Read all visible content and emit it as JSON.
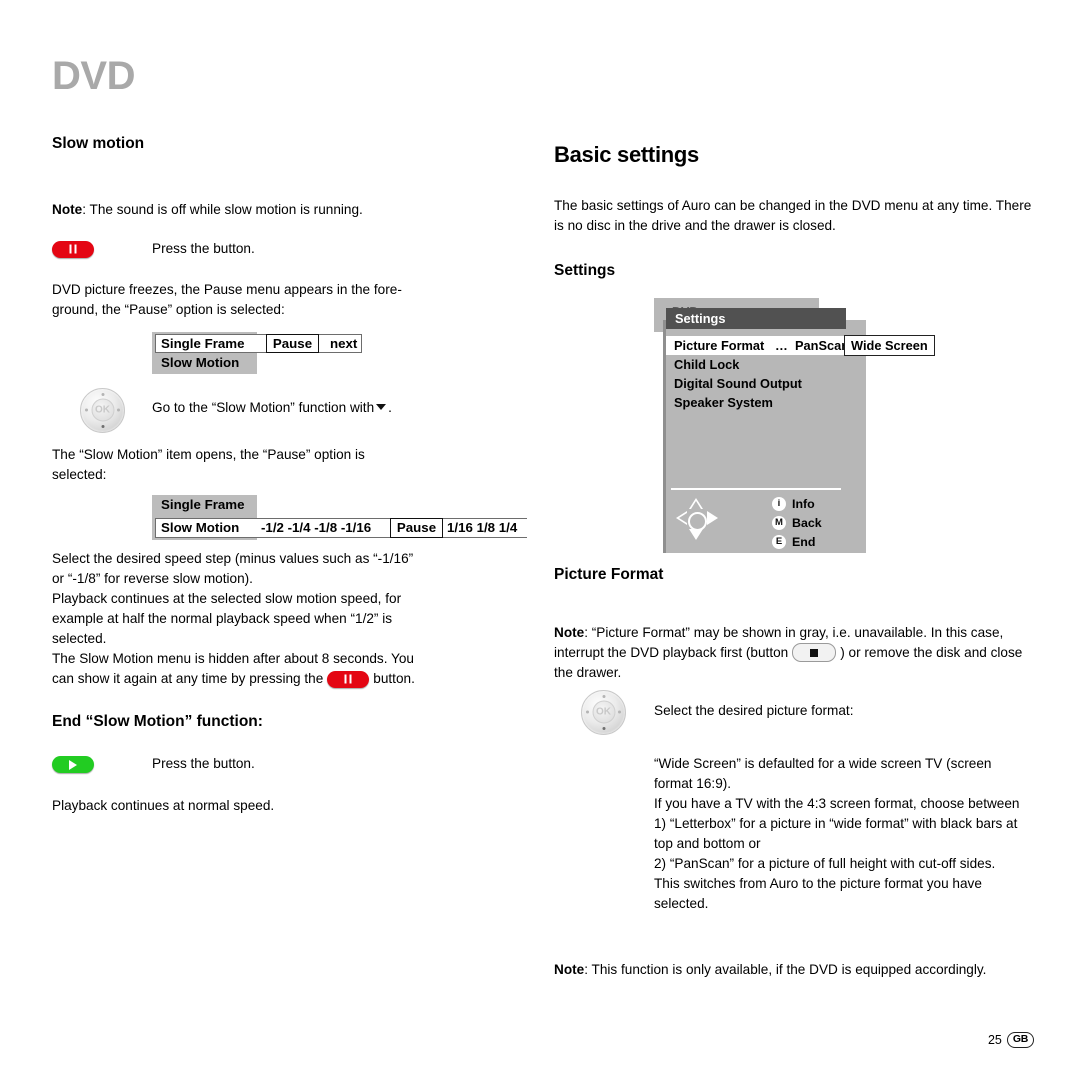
{
  "document": {
    "chapter_title": "DVD",
    "page_number": "25",
    "country_code": "GB"
  },
  "left_column": {
    "section_title": "Slow motion",
    "note_1": {
      "label": "Note",
      "text": ": The sound is off while slow motion is running."
    },
    "step_pause": {
      "button_icon": "pause-button-icon",
      "text": "Press the button."
    },
    "paragraph_1": "DVD picture freezes, the Pause menu appears in the fore-ground, the “Pause” option is selected:",
    "osd_pause_menu": {
      "item_1": "Single Frame",
      "item_2": "Slow Motion",
      "selected_option": "Pause",
      "next_option": "next"
    },
    "step_navigate": {
      "button_icon": "ok-navigation-wheel-icon",
      "text_before": "Go to the “Slow Motion” function with",
      "arrow_icon": "arrow-down-icon",
      "text_after": "."
    },
    "paragraph_2": "The “Slow Motion” item opens, the “Pause” option is selected:",
    "osd_slow_motion_menu": {
      "item_1": "Single Frame",
      "item_2": "Slow Motion",
      "speeds_negative": "-1/2  -1/4  -1/8  -1/16",
      "selected_option": "Pause",
      "speeds_positive": "1/16  1/8  1/4"
    },
    "paragraph_3": "Select the desired speed step (minus values such as “-1/16” or “-1/8” for reverse slow motion).",
    "paragraph_4": "Playback continues at the selected slow motion speed, for example at half the normal playback speed when “1/2” is selected.",
    "paragraph_5a": "The Slow Motion menu is hidden after about 8 seconds. You can show it again at any time by pressing the",
    "paragraph_5_button_icon": "pause-button-icon",
    "paragraph_5b": "button.",
    "end_section_title": "End “Slow Motion” function:",
    "step_play": {
      "button_icon": "play-button-icon",
      "text": "Press the button."
    },
    "paragraph_6": "Playback continues at normal speed."
  },
  "right_column": {
    "section_title": "Basic settings",
    "intro": "The basic settings of Auro can be changed in the DVD menu at any time. There is no disc in the drive and the drawer is closed.",
    "settings_heading": "Settings",
    "dvd_menu": {
      "background_title": "DVD menu",
      "panel_title": "Settings",
      "items": [
        {
          "label": "Picture Format",
          "dots": "…",
          "value_left": "PanScan",
          "value_selected": "Wide Screen",
          "selected": true
        },
        {
          "label": "Child Lock",
          "selected": false
        },
        {
          "label": "Digital Sound Output",
          "selected": false
        },
        {
          "label": "Speaker System",
          "selected": false
        }
      ],
      "navpad_icon": "dpad-navigation-icon",
      "legend": [
        {
          "key": "i",
          "label": "Info"
        },
        {
          "key": "M",
          "label": "Back"
        },
        {
          "key": "E",
          "label": "End"
        }
      ]
    },
    "picture_format_heading": "Picture Format",
    "note_2": {
      "label": "Note",
      "text_a": ": “Picture Format” may be shown in gray, i.e. unavailable. In this case, interrupt the DVD playback first (button",
      "button_icon": "stop-button-icon",
      "text_b": ") or remove the disk and close the drawer."
    },
    "step_select": {
      "button_icon": "ok-navigation-wheel-icon",
      "text": "Select the desired picture format:"
    },
    "paragraph_formats": "“Wide Screen” is defaulted for a wide screen TV (screen format 16:9).\nIf you have a TV with the 4:3 screen format, choose between\n1) “Letterbox” for a picture in “wide format” with black bars at top and bottom or\n2) “PanScan” for a picture of full height with cut-off sides.\nThis switches from Auro to the picture format you have selected.",
    "note_3": {
      "label": "Note",
      "text": ": This function is only available, if the DVD is equipped accordingly."
    }
  },
  "colors": {
    "chapter_gray": "#a9a9a9",
    "pause_red": "#e40613",
    "play_green": "#22cc22",
    "osd_gray": "#bcbcbc",
    "menu_gray": "#b7b7b7",
    "menu_titlebar": "#515151"
  }
}
